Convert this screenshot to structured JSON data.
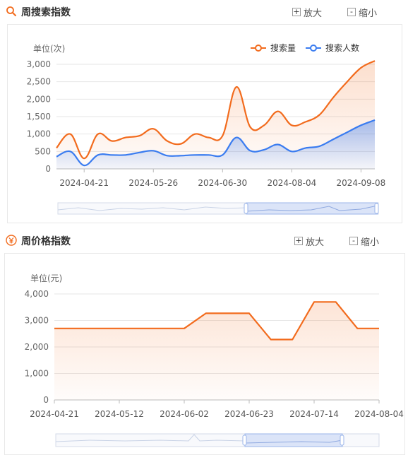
{
  "search_section": {
    "title": "周搜索指数",
    "icon": "search-icon",
    "zoom_in_label": "放大",
    "zoom_out_label": "缩小",
    "accent": "#f26b1d"
  },
  "price_section": {
    "title": "周价格指数",
    "icon": "yen-icon",
    "zoom_in_label": "放大",
    "zoom_out_label": "缩小",
    "accent": "#f26b1d"
  },
  "chart_data": [
    {
      "type": "area",
      "unit_label": "单位(次)",
      "ylim": [
        0,
        3000
      ],
      "yticks": [
        "0",
        "500",
        "1,000",
        "1,500",
        "2,000",
        "2,500",
        "3,000"
      ],
      "ytick_values": [
        0,
        500,
        1000,
        1500,
        2000,
        2500,
        3000
      ],
      "xtick_labels": [
        "2024-04-21",
        "2024-05-26",
        "2024-06-30",
        "2024-08-04",
        "2024-09-08"
      ],
      "x": [
        "2024-04-07",
        "2024-04-14",
        "2024-04-21",
        "2024-04-28",
        "2024-05-05",
        "2024-05-12",
        "2024-05-19",
        "2024-05-26",
        "2024-06-02",
        "2024-06-09",
        "2024-06-16",
        "2024-06-23",
        "2024-06-30",
        "2024-07-07",
        "2024-07-14",
        "2024-07-21",
        "2024-07-28",
        "2024-08-04",
        "2024-08-11",
        "2024-08-18",
        "2024-08-25",
        "2024-09-01",
        "2024-09-08",
        "2024-09-15"
      ],
      "legend_position": "top-right",
      "grid": true,
      "series": [
        {
          "name": "搜索量",
          "color": "#f26b1d",
          "values": [
            600,
            1000,
            300,
            1000,
            800,
            900,
            950,
            1150,
            800,
            720,
            1000,
            900,
            950,
            2350,
            1200,
            1250,
            1650,
            1250,
            1350,
            1550,
            2050,
            2500,
            2900,
            3100
          ]
        },
        {
          "name": "搜索人数",
          "color": "#3a7cf0",
          "values": [
            350,
            500,
            100,
            400,
            400,
            400,
            470,
            520,
            380,
            380,
            400,
            400,
            400,
            900,
            520,
            550,
            700,
            500,
            600,
            650,
            850,
            1050,
            1250,
            1400
          ]
        }
      ]
    },
    {
      "type": "area",
      "unit_label": "单位(元)",
      "ylim": [
        0,
        4000
      ],
      "yticks": [
        "0",
        "1,000",
        "2,000",
        "3,000",
        "4,000"
      ],
      "ytick_values": [
        0,
        1000,
        2000,
        3000,
        4000
      ],
      "xtick_labels": [
        "2024-04-21",
        "2024-05-12",
        "2024-06-02",
        "2024-06-23",
        "2024-07-14",
        "2024-08-04"
      ],
      "x": [
        "2024-04-21",
        "2024-04-28",
        "2024-05-05",
        "2024-05-12",
        "2024-05-19",
        "2024-05-26",
        "2024-06-02",
        "2024-06-09",
        "2024-06-16",
        "2024-06-23",
        "2024-06-30",
        "2024-07-07",
        "2024-07-14",
        "2024-07-21",
        "2024-07-28",
        "2024-08-04"
      ],
      "grid": true,
      "series": [
        {
          "name": "",
          "color": "#f26b1d",
          "values": [
            2700,
            2700,
            2700,
            2700,
            2700,
            2700,
            2700,
            3270,
            3270,
            3270,
            2280,
            2280,
            3700,
            3700,
            2700,
            2700
          ]
        }
      ]
    }
  ]
}
